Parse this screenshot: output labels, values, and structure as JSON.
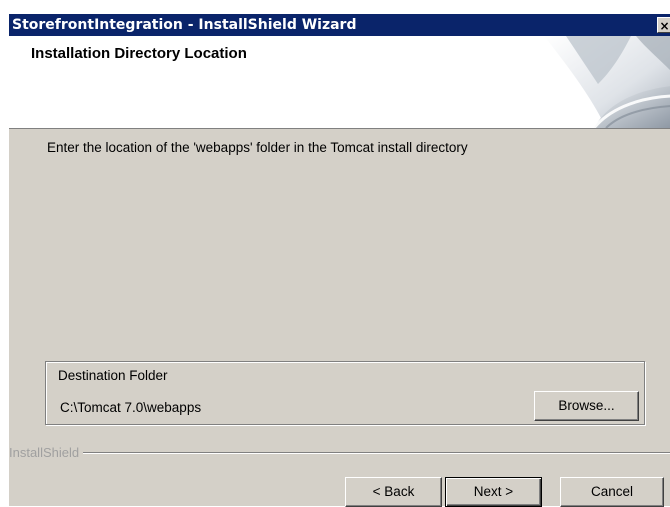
{
  "window": {
    "title": "StorefrontIntegration - InstallShield Wizard",
    "close_glyph": "×"
  },
  "header": {
    "title": "Installation Directory Location"
  },
  "main": {
    "instruction": "Enter the location of the 'webapps' folder in the Tomcat install directory"
  },
  "destination": {
    "legend": "Destination Folder",
    "path": "C:\\Tomcat 7.0\\webapps",
    "browse_label": "Browse..."
  },
  "footer": {
    "brand": "InstallShield",
    "back_label": "< Back",
    "next_label": "Next >",
    "cancel_label": "Cancel"
  },
  "colors": {
    "titlebar": "#0a246a",
    "dialog_background": "#d4d0c8",
    "header_background": "#ffffff"
  },
  "icons": {
    "header_graphic": "page-curl-icon",
    "close": "close-icon"
  }
}
